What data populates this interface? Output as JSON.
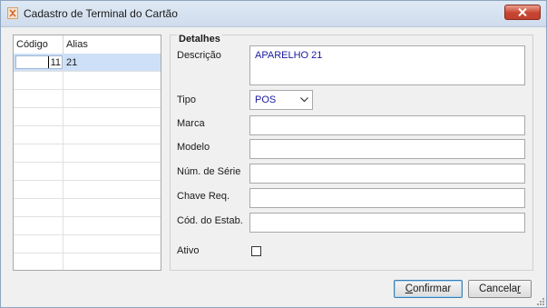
{
  "window": {
    "title": "Cadastro de Terminal do Cartão"
  },
  "grid": {
    "columns": [
      "Código",
      "Alias"
    ],
    "rows": [
      {
        "codigo": "11",
        "alias": "21",
        "selected": true
      }
    ],
    "empty_rows": 11
  },
  "details": {
    "group_title": "Detalhes",
    "labels": {
      "descricao": "Descrição",
      "tipo": "Tipo",
      "marca": "Marca",
      "modelo": "Modelo",
      "num_serie": "Núm. de Série",
      "chave_req": "Chave Req.",
      "cod_estab": "Cód. do Estab.",
      "ativo": "Ativo"
    },
    "values": {
      "descricao": "APARELHO 21",
      "tipo": "POS",
      "marca": "",
      "modelo": "",
      "num_serie": "",
      "chave_req": "",
      "cod_estab": ""
    },
    "ativo_checked": false
  },
  "buttons": {
    "confirm_pre": "",
    "confirm_u": "C",
    "confirm_post": "onfirmar",
    "cancel_pre": "Cancela",
    "cancel_u": "r",
    "cancel_post": ""
  },
  "icons": {
    "app": "app-icon",
    "close": "close-icon",
    "dropdown": "chevron-down-icon"
  }
}
